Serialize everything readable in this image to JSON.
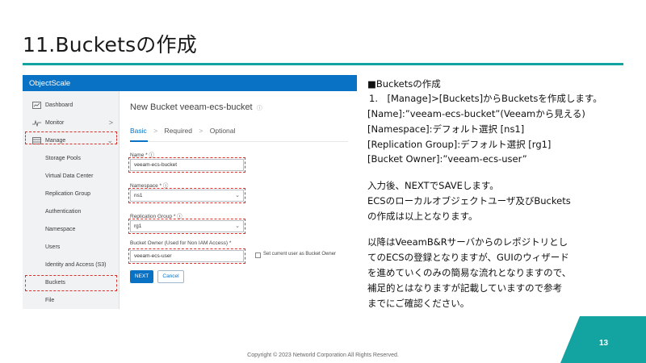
{
  "slide": {
    "title": "11.Bucketsの作成",
    "copyright": "Copyright © 2023 Networld Corporation All Rights Reserved.",
    "page_number": "13",
    "accent_color": "#13a3a0"
  },
  "app": {
    "name": "ObjectScale",
    "header_color": "#0a72c4",
    "sidebar": [
      {
        "label": "Dashboard",
        "icon": "dashboard-icon",
        "level": "top"
      },
      {
        "label": "Monitor",
        "icon": "monitor-icon",
        "level": "top",
        "chevron": ">"
      },
      {
        "label": "Manage",
        "icon": "manage-icon",
        "level": "top",
        "chevron": "⌄"
      },
      {
        "label": "Storage Pools",
        "level": "sub"
      },
      {
        "label": "Virtual Data Center",
        "level": "sub"
      },
      {
        "label": "Replication Group",
        "level": "sub"
      },
      {
        "label": "Authentication",
        "level": "sub"
      },
      {
        "label": "Namespace",
        "level": "sub"
      },
      {
        "label": "Users",
        "level": "sub"
      },
      {
        "label": "Identity and Access (S3)",
        "level": "sub"
      },
      {
        "label": "Buckets",
        "level": "sub"
      },
      {
        "label": "File",
        "level": "sub"
      }
    ],
    "page_heading": "New Bucket veeam-ecs-bucket",
    "info_glyph": "ⓘ",
    "steps": [
      "Basic",
      "Required",
      "Optional"
    ],
    "step_separator": ">",
    "form": {
      "name_label": "Name * ⓘ",
      "name_value": "veeam-ecs-bucket",
      "namespace_label": "Namespace * ⓘ",
      "namespace_value": "ns1",
      "replication_label": "Replication Group * ⓘ",
      "replication_value": "rg1",
      "owner_label": "Bucket Owner (Used for Non IAM Access) *",
      "owner_value": "veeam-ecs-user",
      "set_current_user_label": "Set current user as Bucket Owner",
      "dropdown_glyph": "⌄"
    },
    "buttons": {
      "next": "NEXT",
      "cancel": "Cancel"
    }
  },
  "notes": {
    "lines": [
      "■Bucketsの作成",
      "1.　[Manage]>[Buckets]からBucketsを作成します。",
      "[Name]:”veeam-ecs-bucket”(Veeamから見える)",
      "[Namespace]:デフォルト選択 [ns1]",
      "[Replication Group]:デフォルト選択 [rg1]",
      "[Bucket Owner]:”veeam-ecs-user”",
      "",
      "入力後、NEXTでSAVEします。",
      "ECSのローカルオブジェクトユーザ及びBuckets",
      "の作成は以上となります。",
      "",
      "以降はVeeamB&Rサーバからのレポジトリとし",
      "てのECSの登録となりますが、GUIのウィザード",
      "を進めていくのみの簡易な流れとなりますので、",
      "補足的とはなりますが記載していますので参考",
      "までにご確認ください。"
    ]
  }
}
